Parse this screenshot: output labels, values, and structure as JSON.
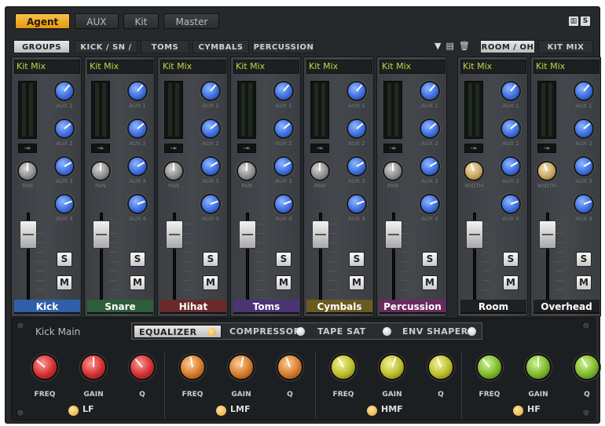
{
  "top_tabs": [
    {
      "label": "Agent",
      "active": true
    },
    {
      "label": "AUX",
      "active": false
    },
    {
      "label": "Kit",
      "active": false
    },
    {
      "label": "Master",
      "active": false
    }
  ],
  "group_tabs": [
    {
      "label": "GROUPS",
      "active": true
    },
    {
      "label": "KICK / SN / HH",
      "active": false
    },
    {
      "label": "TOMS",
      "active": false
    },
    {
      "label": "CYMBALS",
      "active": false
    },
    {
      "label": "PERCUSSION",
      "active": false
    }
  ],
  "right_tabs": [
    {
      "label": "ROOM / OH",
      "active": true
    },
    {
      "label": "KIT MIX",
      "active": false
    }
  ],
  "channels": [
    {
      "name": "Kick",
      "preset": "Kit Mix",
      "color": "#2f5fa8",
      "aux_labels": [
        "AUX 1",
        "AUX 2",
        "AUX 3",
        "AUX 4"
      ],
      "pan_label": "PAN",
      "peak": "-∞",
      "solo": "S",
      "mute": "M"
    },
    {
      "name": "Snare",
      "preset": "Kit Mix",
      "color": "#2e5d3c",
      "aux_labels": [
        "AUX 1",
        "AUX 2",
        "AUX 3",
        "AUX 4"
      ],
      "pan_label": "PAN",
      "peak": "-∞",
      "solo": "S",
      "mute": "M"
    },
    {
      "name": "Hihat",
      "preset": "Kit Mix",
      "color": "#6b2a2a",
      "aux_labels": [
        "AUX 1",
        "AUX 2",
        "AUX 3",
        "AUX 4"
      ],
      "pan_label": "PAN",
      "peak": "-∞",
      "solo": "S",
      "mute": "M"
    },
    {
      "name": "Toms",
      "preset": "Kit Mix",
      "color": "#4a3475",
      "aux_labels": [
        "AUX 1",
        "AUX 2",
        "AUX 3",
        "AUX 4"
      ],
      "pan_label": "PAN",
      "peak": "-∞",
      "solo": "S",
      "mute": "M"
    },
    {
      "name": "Cymbals",
      "preset": "Kit Mix",
      "color": "#6a5a1e",
      "aux_labels": [
        "AUX 1",
        "AUX 2",
        "AUX 3",
        "AUX 4"
      ],
      "pan_label": "PAN",
      "peak": "-∞",
      "solo": "S",
      "mute": "M"
    },
    {
      "name": "Percussion",
      "preset": "Kit Mix",
      "color": "#6a2a5e",
      "aux_labels": [
        "AUX 1",
        "AUX 2",
        "AUX 3",
        "AUX 4"
      ],
      "pan_label": "PAN",
      "peak": "-∞",
      "solo": "S",
      "mute": "M"
    },
    {
      "name": "Room",
      "preset": "Kit Mix",
      "color": "#1f2022",
      "aux_labels": [
        "AUX 1",
        "AUX 2",
        "AUX 3",
        "AUX 4"
      ],
      "pan_label": "WIDTH",
      "peak": "-∞",
      "solo": "S",
      "mute": "M"
    },
    {
      "name": "Overhead",
      "preset": "Kit Mix",
      "color": "#1f2022",
      "aux_labels": [
        "AUX 1",
        "AUX 2",
        "AUX 3",
        "AUX 4"
      ],
      "pan_label": "WIDTH",
      "peak": "-∞",
      "solo": "S",
      "mute": "M"
    }
  ],
  "eq_section": {
    "channel_label": "Kick Main",
    "processor_tabs": [
      {
        "label": "EQUALIZER",
        "active": true
      },
      {
        "label": "COMPRESSOR",
        "active": false
      },
      {
        "label": "TAPE SAT",
        "active": false
      },
      {
        "label": "ENV SHAPER",
        "active": false
      }
    ],
    "bands": [
      {
        "name": "LF",
        "knob_color": "red",
        "labels": [
          "FREQ",
          "GAIN",
          "Q"
        ]
      },
      {
        "name": "LMF",
        "knob_color": "orange",
        "labels": [
          "FREQ",
          "GAIN",
          "Q"
        ]
      },
      {
        "name": "HMF",
        "knob_color": "yellow-green",
        "labels": [
          "FREQ",
          "GAIN",
          "Q"
        ]
      },
      {
        "name": "HF",
        "knob_color": "green",
        "labels": [
          "FREQ",
          "GAIN",
          "Q"
        ]
      }
    ]
  },
  "icons": [
    "dropdown-arrow-icon",
    "save-icon",
    "delete-icon",
    "layout-icon",
    "settings-icon"
  ]
}
